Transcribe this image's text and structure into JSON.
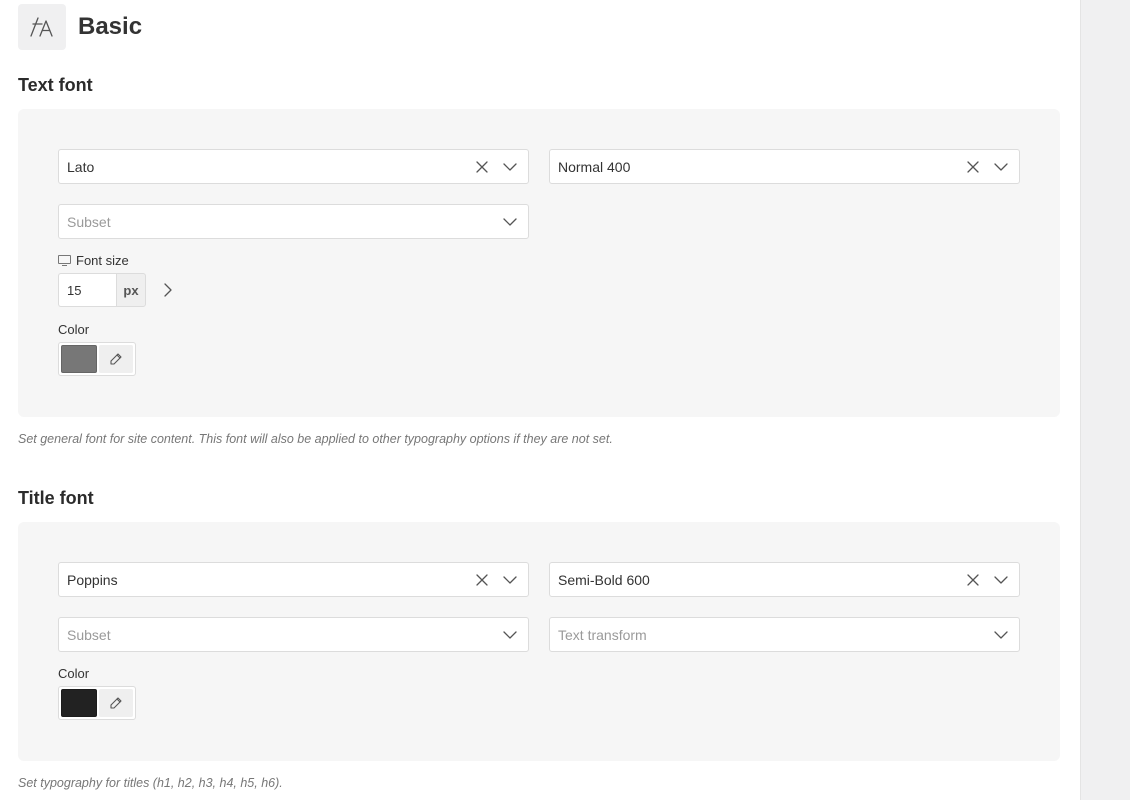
{
  "header": {
    "title": "Basic",
    "icon": "font-icon"
  },
  "text_font": {
    "title": "Text font",
    "family": {
      "value": "Lato"
    },
    "weight": {
      "value": "Normal 400"
    },
    "subset": {
      "placeholder": "Subset"
    },
    "font_size": {
      "label": "Font size",
      "value": "15",
      "unit": "px"
    },
    "color": {
      "label": "Color",
      "swatch": "#777777"
    },
    "description": "Set general font for site content. This font will also be applied to other typography options if they are not set."
  },
  "title_font": {
    "title": "Title font",
    "family": {
      "value": "Poppins"
    },
    "weight": {
      "value": "Semi-Bold 600"
    },
    "subset": {
      "placeholder": "Subset"
    },
    "text_transform": {
      "placeholder": "Text transform"
    },
    "color": {
      "label": "Color",
      "swatch": "#222222"
    },
    "description": "Set typography for titles (h1, h2, h3, h4, h5, h6)."
  }
}
